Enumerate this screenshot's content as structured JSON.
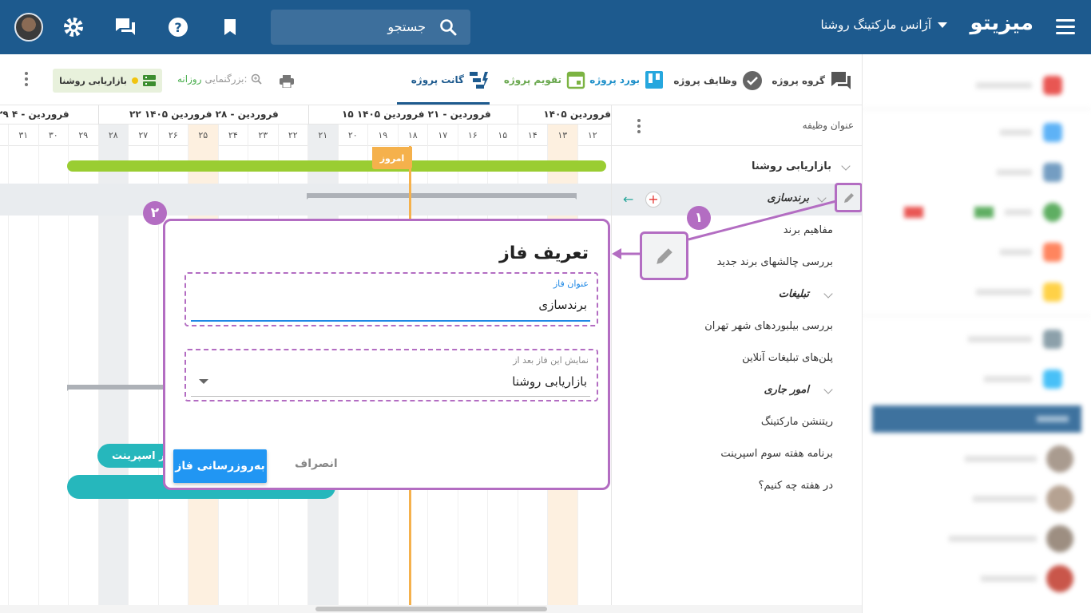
{
  "header": {
    "brand": "میزیتو",
    "workspace": "آژانس مارکتینگ روشنا",
    "search_label": "جستجو"
  },
  "tabs": [
    {
      "label": "گروه پروژه",
      "icon": "chat-group-icon"
    },
    {
      "label": "وظایف پروژه",
      "icon": "check-circle-icon"
    },
    {
      "label": "بورد پروژه",
      "icon": "board-icon"
    },
    {
      "label": "تقویم پروژه",
      "icon": "calendar-icon"
    },
    {
      "label": "گانت پروژه",
      "icon": "gantt-icon",
      "active": true
    }
  ],
  "toolbar": {
    "zoom_label": "بزرگنمایی:",
    "zoom_value": "روزانه",
    "filter_chip": "بازاریابی روشنا"
  },
  "gantt": {
    "months": [
      "۱۴۰۵ فروردین",
      "۱۵ فروردین - ۲۱ فروردین ۱۴۰۵",
      "۲۲ فروردین - ۲۸ فروردین ۱۴۰۵",
      "۲۹ فروردین - ۴"
    ],
    "days": [
      "۱۲",
      "۱۳",
      "۱۴",
      "۱۵",
      "۱۶",
      "۱۷",
      "۱۸",
      "۱۹",
      "۲۰",
      "۲۱",
      "۲۲",
      "۲۳",
      "۲۴",
      "۲۵",
      "۲۶",
      "۲۷",
      "۲۸",
      "۲۹",
      "۳۰",
      "۳۱"
    ],
    "today_label": "امروز",
    "teal_bar_label": "ر اسپرینت"
  },
  "tasklist": {
    "header": "عنوان وظیفه",
    "rows": [
      {
        "label": "بازاریابی روشنا",
        "type": "group",
        "top": 0
      },
      {
        "label": "برندسازی",
        "type": "group"
      },
      {
        "label": "مفاهیم برند",
        "type": "task"
      },
      {
        "label": "بررسی چالشهای برند جدید",
        "type": "task"
      },
      {
        "label": "تبلیغات",
        "type": "group"
      },
      {
        "label": "بررسی بیلبوردهای شهر تهران",
        "type": "task"
      },
      {
        "label": "پلن‌های تبلیغات آنلاین",
        "type": "task"
      },
      {
        "label": "امور جاری",
        "type": "group"
      },
      {
        "label": "ریتنشن مارکتینگ",
        "type": "task"
      },
      {
        "label": "برنامه هفته سوم اسپرینت",
        "type": "task"
      },
      {
        "label": "در هفته چه کنیم؟",
        "type": "task"
      }
    ]
  },
  "dialog": {
    "title": "تعریف فاز",
    "field1_label": "عنوان فاز",
    "field1_value": "برندسازی",
    "field2_label": "نمایش این فاز بعد از",
    "field2_value": "بازاریابی روشنا",
    "submit_label": "به‌روزرسانی فاز",
    "cancel_label": "انصراف"
  },
  "annotations": {
    "badge1": "۱",
    "badge2": "۲"
  },
  "colors": {
    "brand": "#1d5a8e",
    "accent": "#b36dc2",
    "primary_button": "#2196f3",
    "today": "#f5b14c",
    "progress_green": "#9acd32",
    "teal": "#26b7bc"
  }
}
